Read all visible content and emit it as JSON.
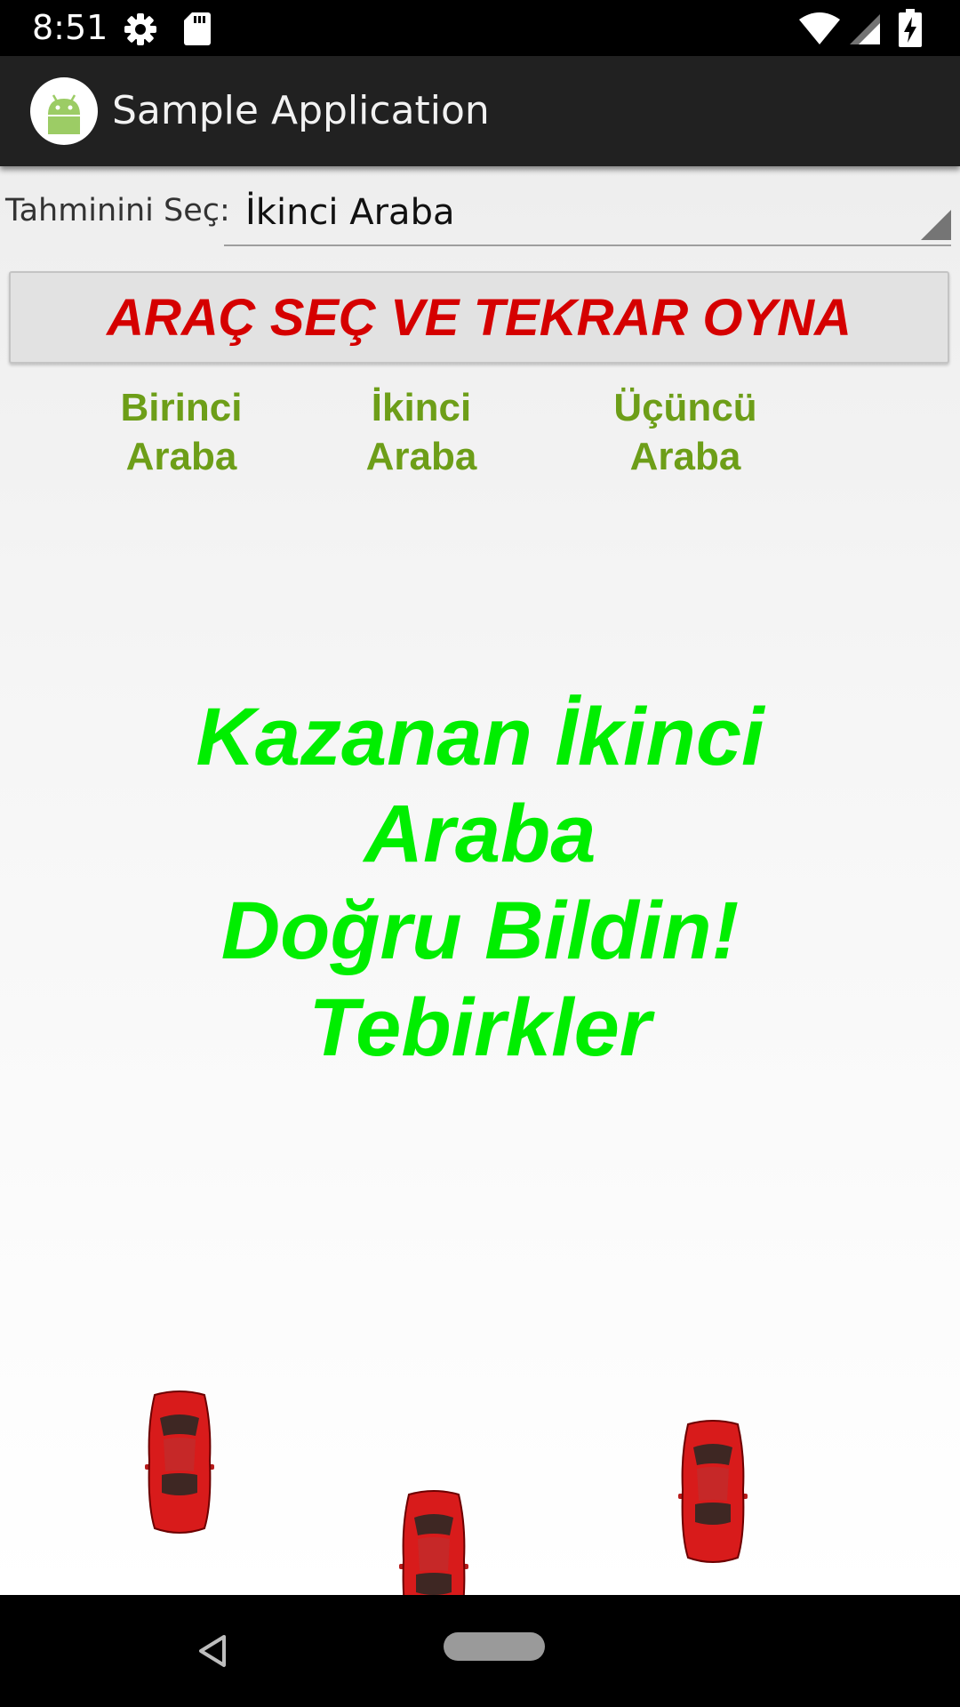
{
  "status_bar": {
    "time": "8:51",
    "icons": [
      "gear-icon",
      "sd-card-icon",
      "wifi-icon",
      "signal-icon",
      "battery-charging-icon"
    ]
  },
  "app_bar": {
    "title": "Sample Application",
    "logo_icon": "android-robot-icon"
  },
  "prediction": {
    "label": "Tahminini Seç:",
    "selected": "İkinci Araba"
  },
  "play_button": {
    "label": "ARAÇ SEÇ VE TEKRAR OYNA",
    "color": "#d50000"
  },
  "columns": [
    {
      "label": "Birinci\nAraba"
    },
    {
      "label": "İkinci\nAraba"
    },
    {
      "label": "Üçüncü\nAraba"
    }
  ],
  "result": {
    "text": "Kazanan İkinci\nAraba\nDoğru Bildin!\nTebirkler",
    "color": "#00ee00"
  },
  "cars": [
    {
      "name": "car-1",
      "color": "#d81b1b"
    },
    {
      "name": "car-2",
      "color": "#d81b1b"
    },
    {
      "name": "car-3",
      "color": "#d81b1b"
    }
  ],
  "nav_bar": {
    "icons": [
      "back-icon",
      "home-pill-icon"
    ]
  }
}
